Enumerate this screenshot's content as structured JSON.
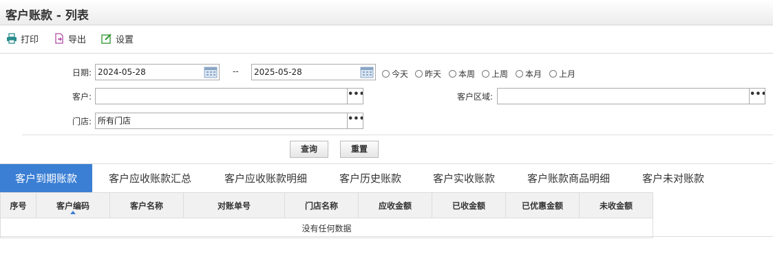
{
  "title": "客户账款 - 列表",
  "toolbar": {
    "print": "打印",
    "export": "导出",
    "settings": "设置"
  },
  "filters": {
    "date_label": "日期:",
    "date_from": "2024-05-28",
    "date_sep": "--",
    "date_to": "2025-05-28",
    "quick": [
      "今天",
      "昨天",
      "本周",
      "上周",
      "本月",
      "上月"
    ],
    "customer_label": "客户:",
    "customer_value": "",
    "region_label": "客户区域:",
    "region_value": "",
    "store_label": "门店:",
    "store_value": "所有门店",
    "picker": "•••"
  },
  "buttons": {
    "query": "查询",
    "reset": "重置"
  },
  "tabs": [
    "客户到期账款",
    "客户应收账款汇总",
    "客户应收账款明细",
    "客户历史账款",
    "客户实收账款",
    "客户账款商品明细",
    "客户未对账款"
  ],
  "active_tab": 0,
  "table": {
    "columns": [
      "序号",
      "客户编码",
      "客户名称",
      "对账单号",
      "门店名称",
      "应收金额",
      "已收金额",
      "已优惠金额",
      "未收金额"
    ],
    "sorted_column": 1,
    "empty": "没有任何数据"
  },
  "colors": {
    "accent": "#3b7fd4"
  }
}
